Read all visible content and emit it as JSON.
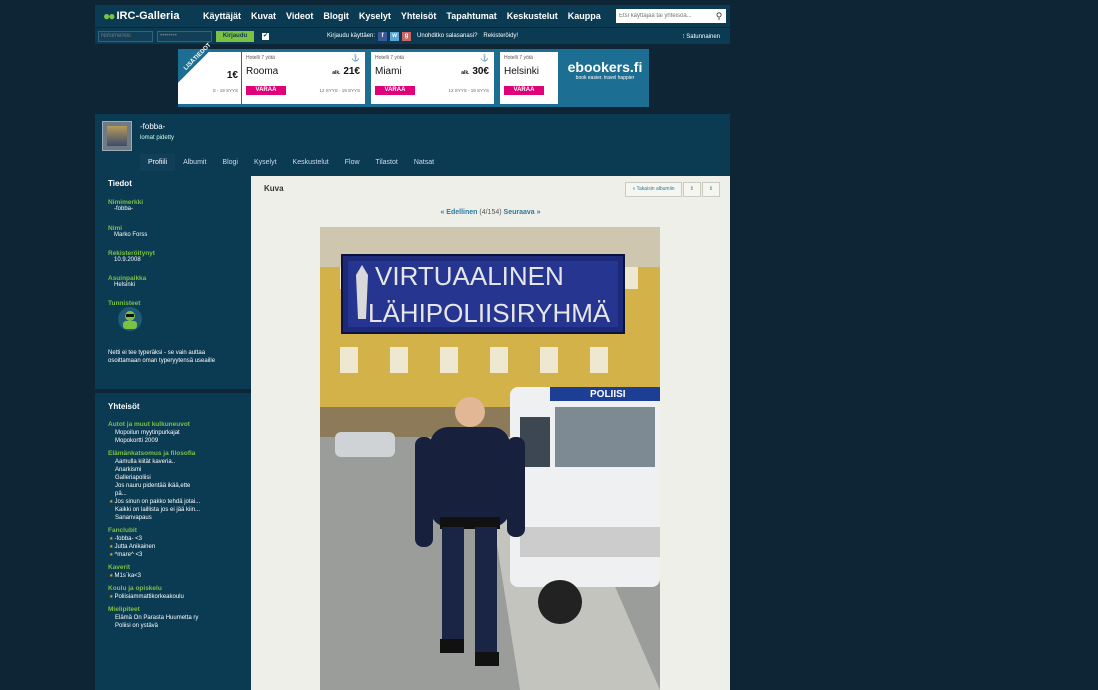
{
  "topnav": {
    "logo": "IRC-Galleria",
    "links": [
      "Käyttäjät",
      "Kuvat",
      "Videot",
      "Blogit",
      "Kyselyt",
      "Yhteisöt",
      "Tapahtumat",
      "Keskustelut",
      "Kauppa"
    ],
    "search_placeholder": "Etsi käyttäjää tai yhteisöä..."
  },
  "login": {
    "nick_placeholder": "Nimimerkki",
    "password_placeholder": "••••••••",
    "button": "Kirjaudu",
    "checkbox": "✔",
    "login_with": "Kirjaudu käyttäen:",
    "forgot": "Unohditko salasanasi?",
    "register": "Rekisteröidy!",
    "random": "Satunnainen"
  },
  "banner": {
    "ribbon": "LISÄTIEDOT",
    "deals": [
      {
        "label": "Hotelli 7 yötä",
        "city": "",
        "price_prefix": "",
        "price": "1€",
        "button": "VARAA",
        "dates": "S - 19 SYYS"
      },
      {
        "label": "Hotelli 7 yötä",
        "city": "Rooma",
        "price_prefix": "alk.",
        "price": "21€",
        "button": "VARAA",
        "dates": "12 SYYS - 19 SYYS"
      },
      {
        "label": "Hotelli 7 yötä",
        "city": "Miami",
        "price_prefix": "alk.",
        "price": "30€",
        "button": "VARAA",
        "dates": "12 SYYS - 19 SYYS"
      },
      {
        "label": "Hotelli 7 yötä",
        "city": "Helsinki",
        "price_prefix": "",
        "price": "",
        "button": "VARAA",
        "dates": "12 SYYS - 19 SYYS"
      }
    ],
    "brand": "ebookers.fi",
    "tagline": "book easier. travel happier"
  },
  "profile": {
    "username": "-fobba-",
    "status": "lomat pidetty",
    "tabs": [
      "Profiili",
      "Albumit",
      "Blogi",
      "Kyselyt",
      "Keskustelut",
      "Flow",
      "Tilastot",
      "Natsat"
    ]
  },
  "info": {
    "title": "Tiedot",
    "fields": [
      {
        "label": "Nimimerkki",
        "value": "-fobba-"
      },
      {
        "label": "Nimi",
        "value": "Marko Forss"
      },
      {
        "label": "Rekisteröitynyt",
        "value": "10.9.2008"
      },
      {
        "label": "Asuinpaikka",
        "value": "Helsinki"
      }
    ],
    "tags_label": "Tunnisteet",
    "signature": "Netti ei tee typeräksi - se vain auttaa osoittamaan oman typeryytensä useaille"
  },
  "communities": {
    "title": "Yhteisöt",
    "groups": [
      {
        "name": "Autot ja muut kulkuneuvot",
        "items": [
          {
            "t": "Mopoilun myytinpurkajat",
            "s": false
          },
          {
            "t": "Mopokortti 2009",
            "s": false
          }
        ]
      },
      {
        "name": "Elämänkatsomus ja filosofia",
        "items": [
          {
            "t": "Aamulla kiität kaveria..",
            "s": false
          },
          {
            "t": "Anarkismi",
            "s": false
          },
          {
            "t": "Galleriapoliisi",
            "s": false
          },
          {
            "t": "Jos nauru pidentää ikää,ette",
            "s": false
          },
          {
            "t": "pä...",
            "s": false
          },
          {
            "t": "Jos sinun on pakko tehdä jotai...",
            "s": true
          },
          {
            "t": "Kaikki on laillista jos ei jää kiin...",
            "s": false
          },
          {
            "t": "Sananvapaus",
            "s": false
          }
        ]
      },
      {
        "name": "Fanclubit",
        "items": [
          {
            "t": "-fobba- <3",
            "s": true
          },
          {
            "t": "Jutta Anikainen",
            "s": true
          },
          {
            "t": "^mare^ <3",
            "s": true
          }
        ]
      },
      {
        "name": "Kaverit",
        "items": [
          {
            "t": "M1s`ka<3",
            "s": true
          }
        ]
      },
      {
        "name": "Koulu ja opiskelu",
        "items": [
          {
            "t": "Poliisiammattikorkeakoulu",
            "s": true
          }
        ]
      },
      {
        "name": "Mielipiteet",
        "items": [
          {
            "t": "Elämä On Parasta Huumetta ry",
            "s": false
          },
          {
            "t": "Poliisi on ystävä",
            "s": false
          }
        ]
      }
    ]
  },
  "photo_panel": {
    "title": "Kuva",
    "back": "« Takaisin albumiin",
    "prev": "« Edellinen",
    "counter": "(4/154)",
    "next": "Seuraava »",
    "sign_line1": "VIRTUAALINEN",
    "sign_line2": "LÄHIPOLIISIRYHMÄ",
    "van_text": "POLIISI"
  },
  "colors": {
    "accent": "#7bc143",
    "nav": "#0b3a53",
    "bg": "#0e2536",
    "link": "#2a7aa3",
    "pink": "#e0007a"
  }
}
